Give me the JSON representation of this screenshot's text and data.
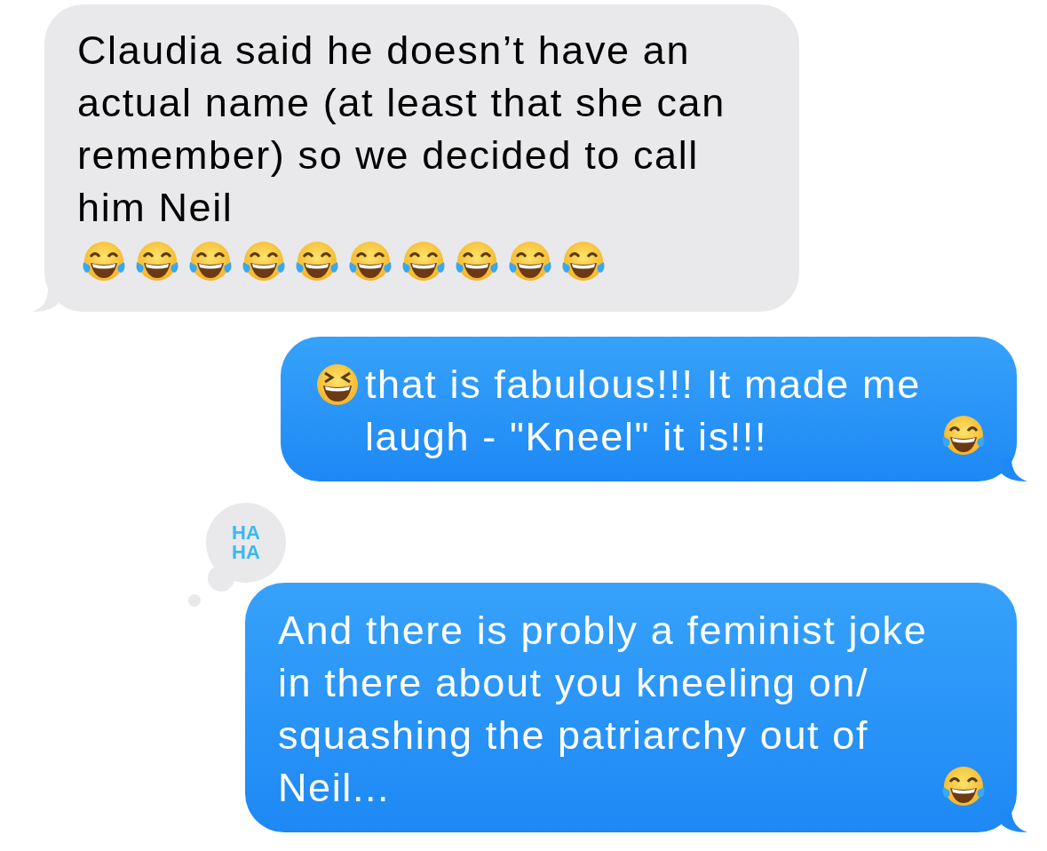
{
  "messages": [
    {
      "kind": "received",
      "lines": [
        [
          {
            "kind": "text",
            "text": "Claudia said he doesn’t have an actual name (at least that she can remember) so we decided to call him Neil"
          }
        ],
        [
          {
            "kind": "tears_of_joy"
          },
          {
            "kind": "tears_of_joy"
          },
          {
            "kind": "tears_of_joy"
          },
          {
            "kind": "tears_of_joy"
          },
          {
            "kind": "tears_of_joy"
          },
          {
            "kind": "tears_of_joy"
          },
          {
            "kind": "tears_of_joy"
          },
          {
            "kind": "tears_of_joy"
          },
          {
            "kind": "tears_of_joy"
          },
          {
            "kind": "tears_of_joy"
          }
        ]
      ]
    },
    {
      "kind": "sent",
      "lines": [
        [
          {
            "kind": "squinting"
          },
          {
            "kind": "text",
            "text": "that is fabulous!!! It made me laugh - \"Kneel\" it is!!!"
          },
          {
            "kind": "tears_of_joy"
          }
        ]
      ]
    },
    {
      "kind": "sent",
      "tapback": {
        "text": "HA HA"
      },
      "lines": [
        [
          {
            "kind": "text",
            "text": "And there is probly a feminist joke in there about you kneeling on/ squashing the patriarchy out of Neil..."
          },
          {
            "kind": "tears_of_joy"
          }
        ]
      ]
    }
  ]
}
